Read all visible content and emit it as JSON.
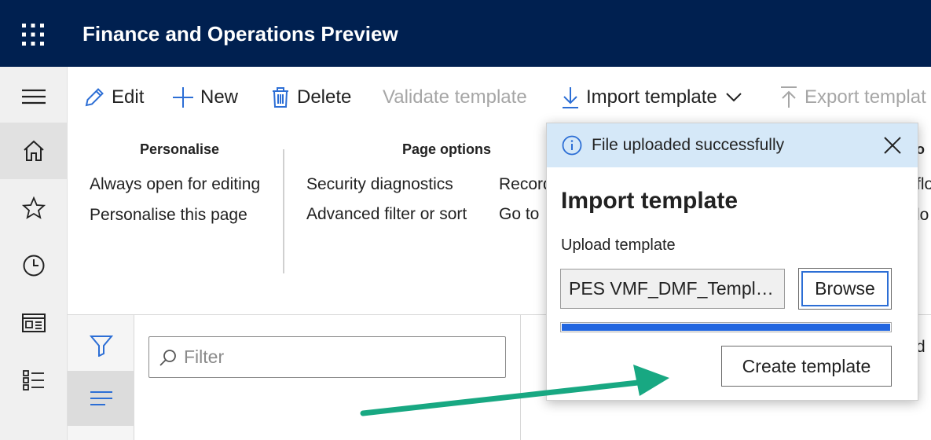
{
  "app": {
    "title": "Finance and Operations Preview"
  },
  "colors": {
    "topbar": "#002050",
    "accent": "#2266e0",
    "arrow": "#18a882",
    "message_bar": "#d5e8f8"
  },
  "nav": {
    "icons": [
      "hamburger-icon",
      "home-icon",
      "star-icon",
      "clock-icon",
      "workspace-icon",
      "modules-list-icon"
    ]
  },
  "actions": {
    "edit": "Edit",
    "new": "New",
    "delete": "Delete",
    "validate": "Validate template",
    "import": "Import template",
    "export": "Export templat"
  },
  "menu": {
    "personalise": {
      "header": "Personalise",
      "items": [
        "Always open for editing",
        "Personalise this page"
      ]
    },
    "page_options": {
      "header": "Page options",
      "items": [
        "Security diagnostics",
        "Advanced filter or sort"
      ],
      "col2_items": [
        "Record",
        "Go to"
      ]
    },
    "right_partial": {
      "header": "o",
      "items": [
        "flo",
        "lo"
      ]
    }
  },
  "filter": {
    "placeholder": "Filter"
  },
  "right_partial_text": "d",
  "dialog": {
    "message": "File uploaded successfully",
    "title": "Import template",
    "upload_label": "Upload template",
    "file_name": "PES VMF_DMF_Template.xlsx",
    "browse": "Browse",
    "progress": 1.0,
    "create": "Create template"
  }
}
